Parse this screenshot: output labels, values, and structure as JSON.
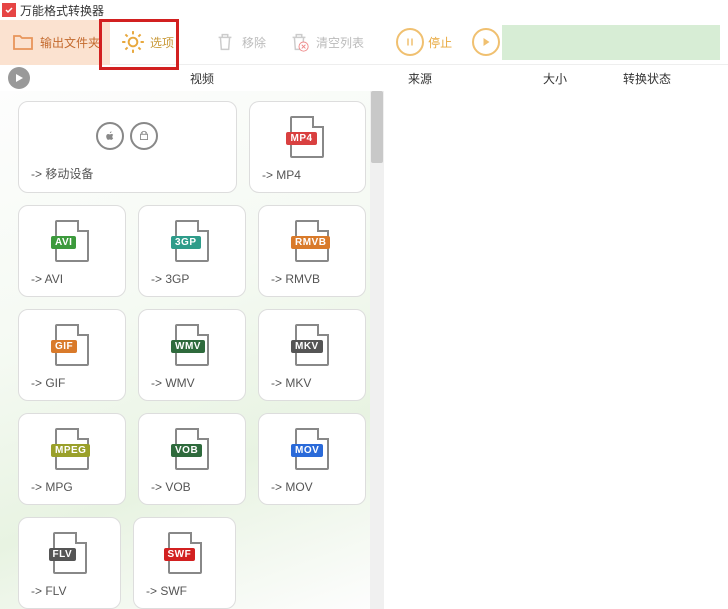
{
  "app": {
    "title": "万能格式转换器"
  },
  "toolbar": {
    "output": "输出文件夹",
    "options": "选项",
    "remove": "移除",
    "clear": "清空列表",
    "stop": "停止",
    "start": "开始"
  },
  "subheader": {
    "section": "视频"
  },
  "columns": {
    "source": "来源",
    "size": "大小",
    "status": "转换状态"
  },
  "formats": {
    "mobile": {
      "label": "-> 移动设备"
    },
    "mp4": {
      "badge": "MP4",
      "color": "#d94040",
      "label": "-> MP4"
    },
    "avi": {
      "badge": "AVI",
      "color": "#3c9a3c",
      "label": "-> AVI"
    },
    "3gp": {
      "badge": "3GP",
      "color": "#2e9c8a",
      "label": "-> 3GP"
    },
    "rmvb": {
      "badge": "RMVB",
      "color": "#d97a2a",
      "label": "-> RMVB"
    },
    "gif": {
      "badge": "GIF",
      "color": "#d97a2a",
      "label": "-> GIF"
    },
    "wmv": {
      "badge": "WMV",
      "color": "#2e6a3c",
      "label": "-> WMV"
    },
    "mkv": {
      "badge": "MKV",
      "color": "#555555",
      "label": "-> MKV"
    },
    "mpeg": {
      "badge": "MPEG",
      "color": "#9aa02a",
      "label": "-> MPG"
    },
    "vob": {
      "badge": "VOB",
      "color": "#2e6a3c",
      "label": "-> VOB"
    },
    "mov": {
      "badge": "MOV",
      "color": "#2a6ad9",
      "label": "-> MOV"
    },
    "flv": {
      "badge": "FLV",
      "color": "#555555",
      "label": "-> FLV"
    },
    "swf": {
      "badge": "SWF",
      "color": "#d22020",
      "label": "-> SWF"
    }
  }
}
